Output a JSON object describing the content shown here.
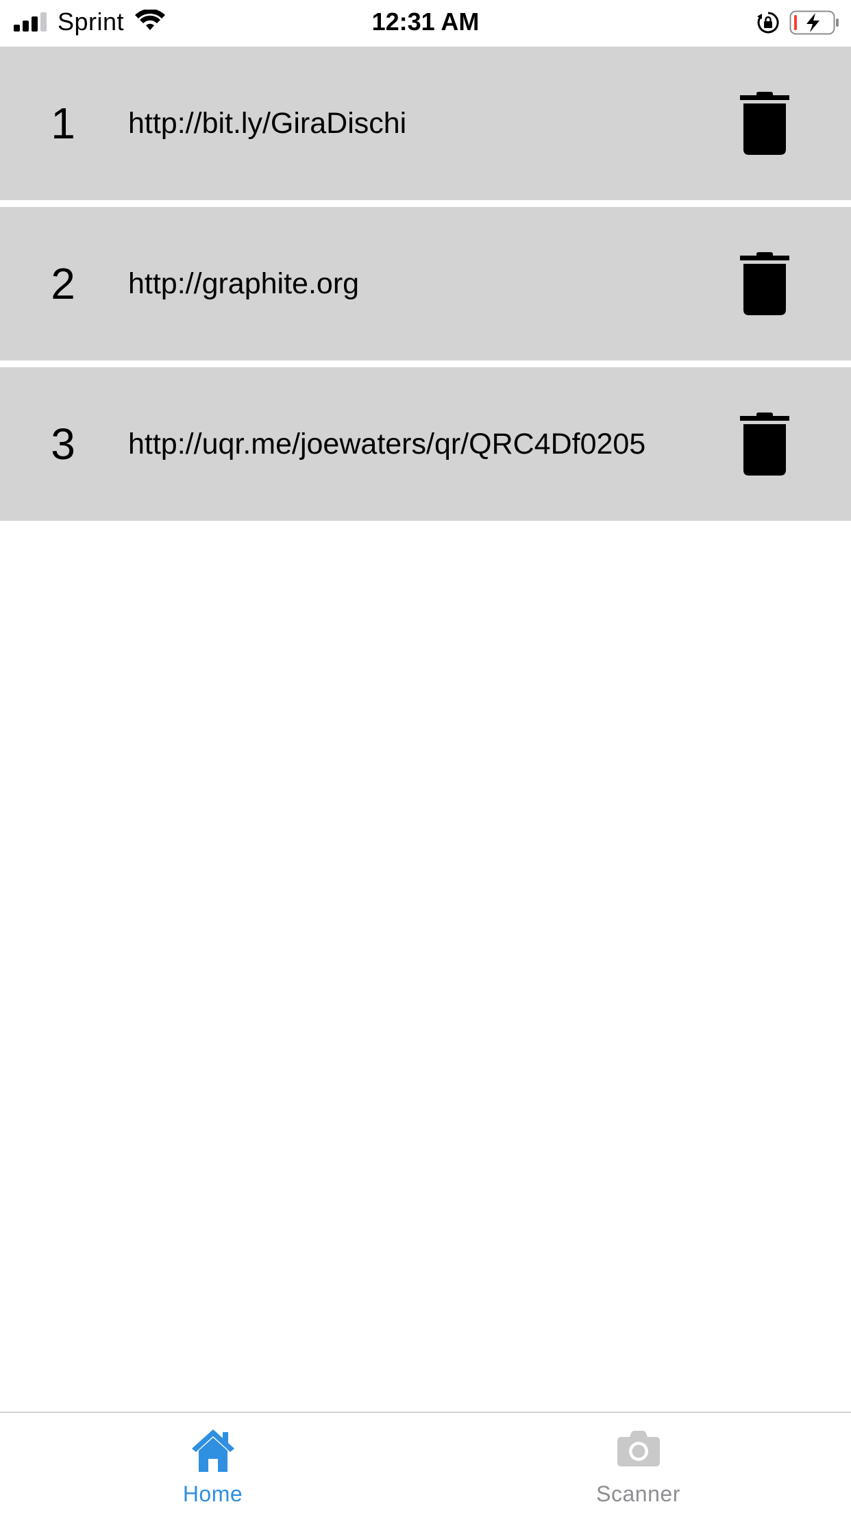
{
  "status_bar": {
    "carrier": "Sprint",
    "time": "12:31 AM"
  },
  "list": {
    "items": [
      {
        "number": "1",
        "url": "http://bit.ly/GiraDischi"
      },
      {
        "number": "2",
        "url": "http://graphite.org"
      },
      {
        "number": "3",
        "url": "http://uqr.me/joewaters/qr/QRC4Df0205"
      }
    ]
  },
  "tab_bar": {
    "home_label": "Home",
    "scanner_label": "Scanner",
    "active_color": "#2f8fe0",
    "inactive_color": "#8e8e93"
  },
  "colors": {
    "row_background": "#d3d3d3",
    "battery_low": "#ff3b30"
  },
  "icons": {
    "delete": "trash-icon",
    "home": "home-icon",
    "scanner": "camera-icon"
  }
}
